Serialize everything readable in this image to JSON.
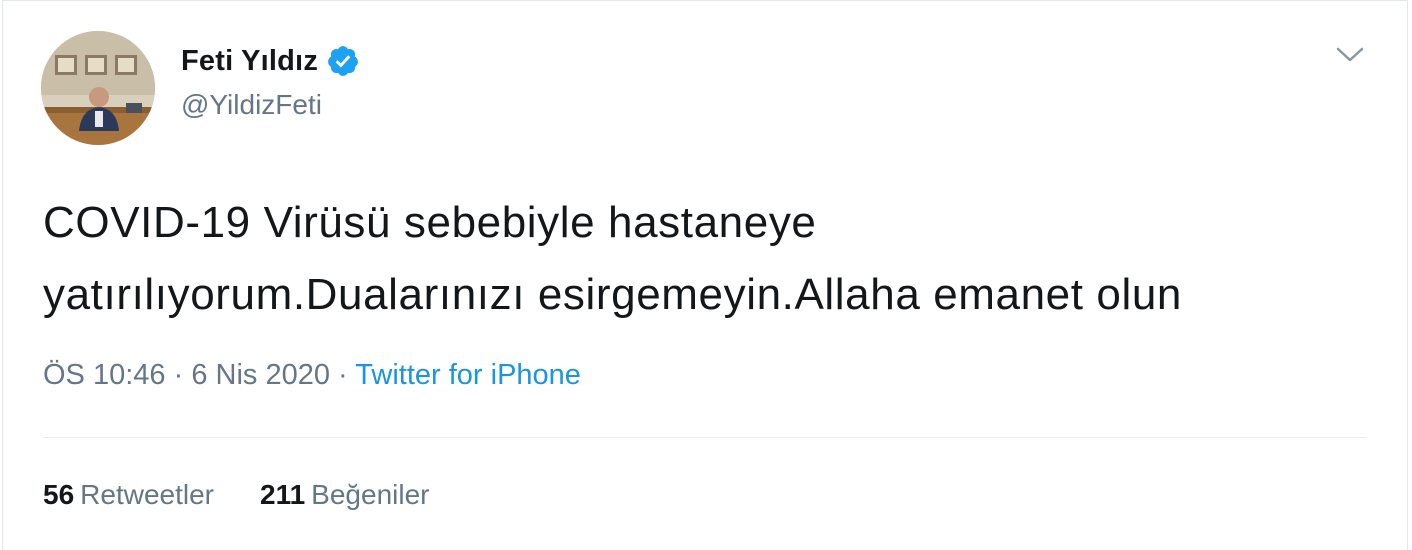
{
  "author": {
    "display_name": "Feti Yıldız",
    "handle": "@YildizFeti",
    "verified_icon": "verified-badge-icon"
  },
  "tweet": {
    "text": "COVID-19 Virüsü sebebiyle hastaneye\nyatırılıyorum.Dualarınızı esirgemeyin.Allaha emanet olun",
    "time": "ÖS 10:46",
    "separator": "·",
    "date": "6 Nis 2020",
    "source": "Twitter for iPhone"
  },
  "stats": {
    "retweets_count": "56",
    "retweets_label": "Retweetler",
    "likes_count": "211",
    "likes_label": "Beğeniler"
  },
  "colors": {
    "text": "#14171a",
    "secondary": "#657786",
    "link": "#1b95e0",
    "verified": "#1da1f2",
    "border": "#e1e8ed"
  },
  "icons": {
    "menu": "chevron-down-icon",
    "verified": "verified-badge-icon"
  }
}
